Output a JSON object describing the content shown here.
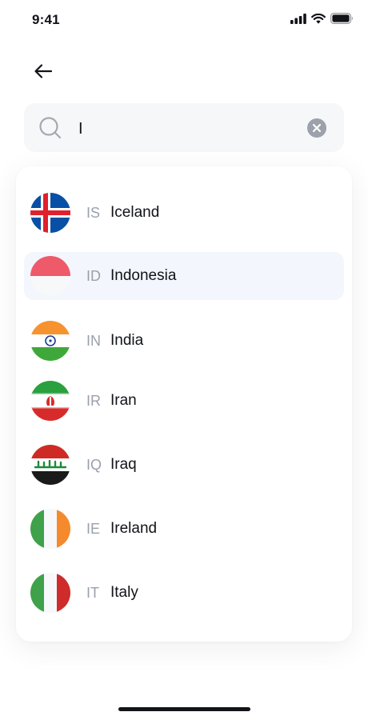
{
  "status_bar": {
    "time": "9:41"
  },
  "search": {
    "query": "I"
  },
  "countries": [
    {
      "code": "IS",
      "name": "Iceland",
      "flag": "iceland-flag"
    },
    {
      "code": "ID",
      "name": "Indonesia",
      "flag": "indonesia-flag",
      "selected": true
    },
    {
      "code": "IN",
      "name": "India",
      "flag": "india-flag"
    },
    {
      "code": "IR",
      "name": "Iran",
      "flag": "iran-flag"
    },
    {
      "code": "IQ",
      "name": "Iraq",
      "flag": "iraq-flag"
    },
    {
      "code": "IE",
      "name": "Ireland",
      "flag": "ireland-flag"
    },
    {
      "code": "IT",
      "name": "Italy",
      "flag": "italy-flag"
    }
  ],
  "colors": {
    "selected_row": "#f3f6fd",
    "code_text": "#9aa0ab",
    "text": "#111318"
  }
}
